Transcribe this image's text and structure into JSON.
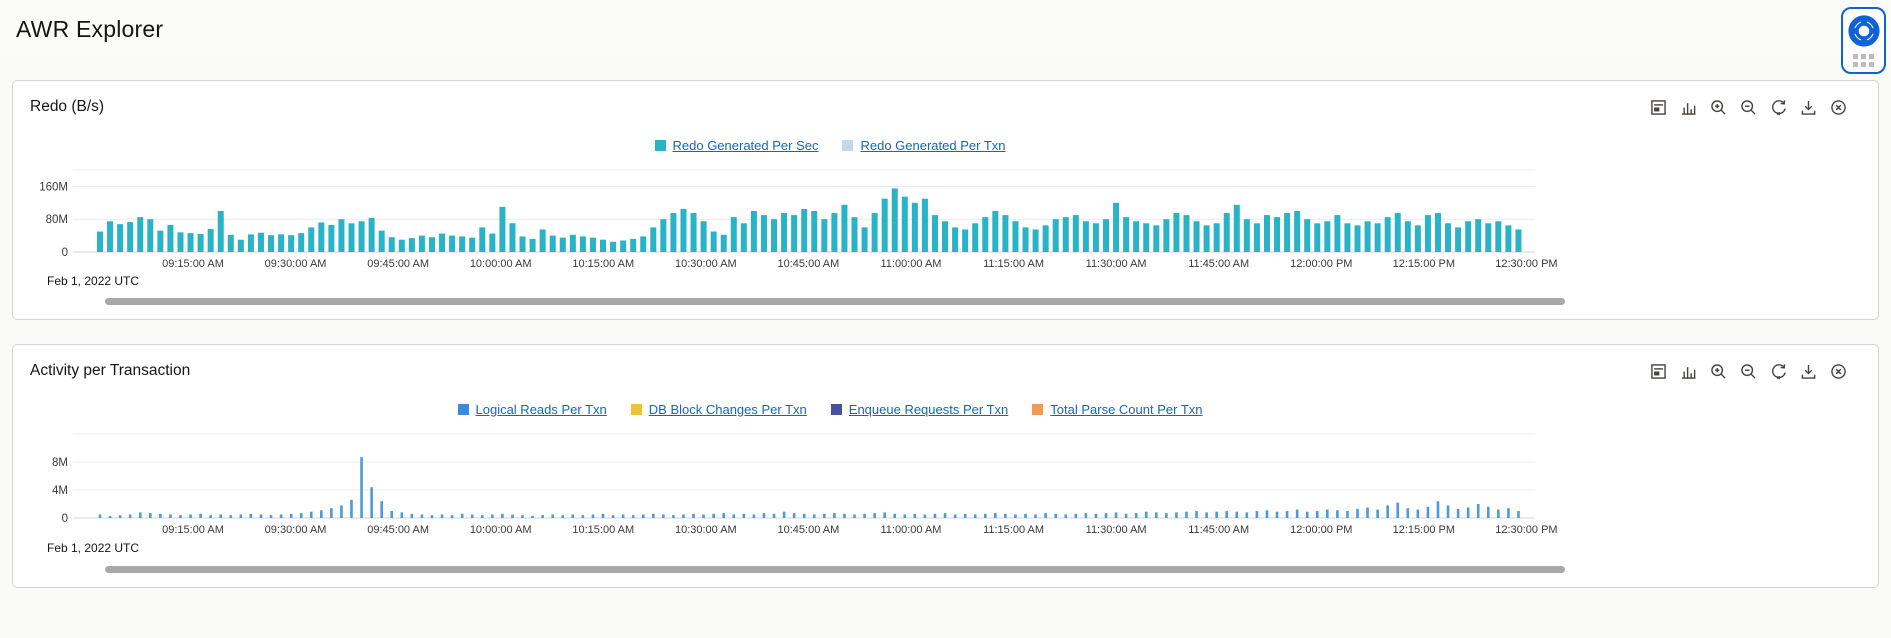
{
  "header": {
    "title": "AWR Explorer"
  },
  "floating_widget": {
    "icon": "life-ring-icon",
    "handle": "drag-handle-dots"
  },
  "toolbar_icons": [
    "view-data-report",
    "bar-chart-type",
    "zoom-in",
    "zoom-out",
    "reset-zoom",
    "download",
    "remove-chart"
  ],
  "panels": [
    {
      "title": "Redo (B/s)"
    },
    {
      "title": "Activity per Transaction"
    }
  ],
  "colors": {
    "accent_blue": "#0f62d6",
    "link_blue": "#1565c0",
    "redo_per_sec": "#29b3c7",
    "redo_per_txn": "#c6d8e7",
    "logical_reads": "#3f8ad6",
    "db_block_changes": "#efc137",
    "enqueue_requests": "#49519e",
    "total_parse_count": "#ef9b55",
    "scrollbar": "#a9a9a9"
  },
  "chart_data": [
    {
      "type": "bar",
      "title": "Redo (B/s)",
      "unit": "M",
      "date_label": "Feb 1, 2022 UTC",
      "ylim": [
        0,
        200
      ],
      "y_tick_values": [
        0,
        80,
        160
      ],
      "y_tick_labels": [
        "0",
        "80M",
        "160M"
      ],
      "grid": true,
      "legend_position": "top-center",
      "n_points": 142,
      "x_tick_labels": [
        "09:15:00 AM",
        "09:30:00 AM",
        "09:45:00 AM",
        "10:00:00 AM",
        "10:15:00 AM",
        "10:30:00 AM",
        "10:45:00 AM",
        "11:00:00 AM",
        "11:15:00 AM",
        "11:30:00 AM",
        "11:45:00 AM",
        "12:00:00 PM",
        "12:15:00 PM",
        "12:30:00 PM"
      ],
      "series": [
        {
          "name": "Redo Generated Per Sec",
          "color": "#29b3c7",
          "values": [
            50,
            75,
            68,
            73,
            85,
            80,
            52,
            66,
            48,
            46,
            44,
            56,
            100,
            42,
            30,
            43,
            47,
            41,
            43,
            41,
            46,
            60,
            72,
            66,
            80,
            70,
            75,
            83,
            52,
            36,
            30,
            34,
            40,
            36,
            45,
            40,
            38,
            35,
            60,
            45,
            110,
            70,
            38,
            32,
            55,
            40,
            35,
            42,
            38,
            35,
            30,
            25,
            28,
            32,
            38,
            60,
            80,
            95,
            105,
            95,
            75,
            50,
            42,
            85,
            70,
            100,
            90,
            80,
            95,
            90,
            105,
            100,
            80,
            95,
            115,
            85,
            60,
            95,
            130,
            155,
            135,
            120,
            130,
            90,
            75,
            60,
            55,
            70,
            85,
            100,
            90,
            75,
            60,
            55,
            65,
            80,
            85,
            90,
            75,
            70,
            80,
            120,
            85,
            75,
            70,
            65,
            80,
            95,
            90,
            75,
            65,
            70,
            95,
            115,
            80,
            70,
            90,
            85,
            95,
            100,
            80,
            70,
            75,
            90,
            70,
            65,
            75,
            70,
            85,
            95,
            75,
            65,
            90,
            95,
            70,
            60,
            75,
            80,
            70,
            75,
            65,
            55
          ]
        },
        {
          "name": "Redo Generated Per Txn",
          "color": "#c6d8e7",
          "values_sparse": {
            "offset": 28,
            "values": [
              14,
              16,
              12,
              15,
              18,
              13,
              12,
              16,
              14,
              15,
              20,
              17,
              15,
              13,
              12,
              14,
              16,
              13,
              12,
              15,
              14
            ]
          }
        }
      ]
    },
    {
      "type": "bar",
      "title": "Activity per Transaction",
      "unit": "M",
      "date_label": "Feb 1, 2022 UTC",
      "ylim": [
        0,
        12
      ],
      "y_tick_values": [
        0,
        4,
        8
      ],
      "y_tick_labels": [
        "0",
        "4M",
        "8M"
      ],
      "grid": true,
      "legend_position": "top-center",
      "n_points": 142,
      "x_tick_labels": [
        "09:15:00 AM",
        "09:30:00 AM",
        "09:45:00 AM",
        "10:00:00 AM",
        "10:15:00 AM",
        "10:30:00 AM",
        "10:45:00 AM",
        "11:00:00 AM",
        "11:15:00 AM",
        "11:30:00 AM",
        "11:45:00 AM",
        "12:00:00 PM",
        "12:15:00 PM",
        "12:30:00 PM"
      ],
      "series": [
        {
          "name": "Logical Reads Per Txn",
          "color": "#3f8ad6",
          "bar_color": "#4b9ade",
          "values": [
            0.5,
            0.3,
            0.4,
            0.5,
            0.8,
            0.7,
            0.6,
            0.5,
            0.4,
            0.5,
            0.6,
            0.4,
            0.5,
            0.4,
            0.5,
            0.6,
            0.5,
            0.4,
            0.5,
            0.6,
            0.7,
            0.9,
            1.1,
            1.4,
            1.8,
            2.6,
            8.7,
            4.4,
            2.4,
            1.0,
            0.8,
            0.6,
            0.5,
            0.4,
            0.5,
            0.4,
            0.6,
            0.5,
            0.4,
            0.5,
            0.6,
            0.5,
            0.4,
            0.3,
            0.4,
            0.5,
            0.4,
            0.5,
            0.4,
            0.5,
            0.6,
            0.4,
            0.5,
            0.4,
            0.5,
            0.6,
            0.5,
            0.4,
            0.5,
            0.6,
            0.5,
            0.6,
            0.7,
            0.5,
            0.6,
            0.5,
            0.7,
            0.6,
            0.9,
            0.7,
            0.6,
            0.5,
            0.6,
            0.7,
            0.6,
            0.5,
            0.6,
            0.7,
            0.8,
            0.6,
            0.5,
            0.6,
            0.5,
            0.6,
            0.7,
            0.5,
            0.6,
            0.5,
            0.6,
            0.7,
            0.6,
            0.5,
            0.6,
            0.5,
            0.7,
            0.6,
            0.5,
            0.6,
            0.7,
            0.6,
            0.7,
            0.8,
            0.6,
            0.7,
            0.9,
            0.8,
            0.7,
            0.8,
            0.9,
            1.0,
            0.8,
            0.9,
            1.0,
            0.9,
            0.8,
            1.0,
            1.1,
            0.9,
            1.0,
            1.2,
            0.9,
            1.0,
            1.2,
            1.1,
            1.0,
            1.3,
            1.5,
            1.2,
            1.8,
            2.2,
            1.4,
            1.2,
            1.6,
            2.4,
            1.8,
            1.3,
            1.5,
            2.0,
            1.6,
            1.2,
            1.4,
            1.0
          ]
        },
        {
          "name": "DB Block Changes Per Txn",
          "color": "#efc137",
          "values": []
        },
        {
          "name": "Enqueue Requests Per Txn",
          "color": "#49519e",
          "values": []
        },
        {
          "name": "Total Parse Count Per Txn",
          "color": "#ef9b55",
          "values": []
        }
      ]
    }
  ]
}
